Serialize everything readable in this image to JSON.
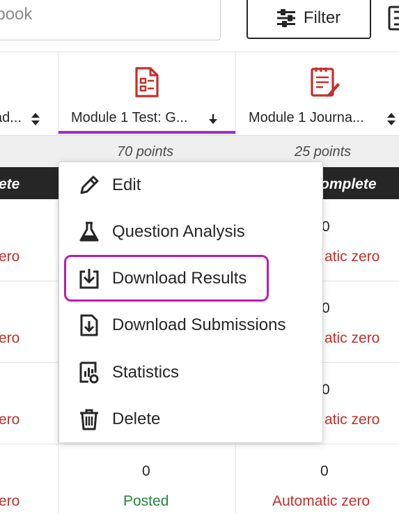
{
  "toolbar": {
    "search_text": "ebook",
    "filter_label": "Filter"
  },
  "columns": [
    {
      "title": "ad...",
      "points": "",
      "status": "ete",
      "rows": [
        {
          "value": "",
          "status": "ero"
        },
        {
          "value": "",
          "status": "ero"
        },
        {
          "value": "",
          "status": "ero"
        },
        {
          "value": "",
          "status": "ero"
        }
      ]
    },
    {
      "title": "Module 1 Test: G...",
      "sort": "↓",
      "points": "70 points",
      "status": "",
      "rows": [
        {
          "value": "0",
          "status": "Posted"
        }
      ]
    },
    {
      "title": "Module 1 Journa...",
      "points": "25 points",
      "status": "omplete",
      "rows": [
        {
          "value": "0",
          "status": "atic zero"
        },
        {
          "value": "0",
          "status": "atic zero"
        },
        {
          "value": "0",
          "status": "atic zero"
        },
        {
          "value": "0",
          "status": "Automatic zero"
        }
      ]
    }
  ],
  "menu": {
    "items": [
      {
        "label": "Edit",
        "icon": "pencil-icon"
      },
      {
        "label": "Question Analysis",
        "icon": "flask-icon"
      },
      {
        "label": "Download Results",
        "icon": "download-tray-icon"
      },
      {
        "label": "Download Submissions",
        "icon": "download-document-icon"
      },
      {
        "label": "Statistics",
        "icon": "statistics-icon"
      },
      {
        "label": "Delete",
        "icon": "trash-icon"
      }
    ]
  },
  "colors": {
    "accent_purple": "#a02dc8",
    "focus_magenta": "#b91db0",
    "assessment_icon_red": "#c2302c",
    "status_red": "#c2302c",
    "status_green": "#1f8a3b"
  }
}
